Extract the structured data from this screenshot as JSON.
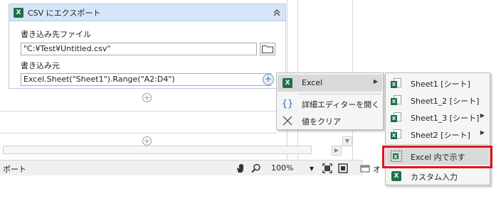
{
  "card": {
    "title": "CSV にエクスポート",
    "dest_label": "書き込み先ファイル",
    "dest_value": "\"C:¥Test¥Untitled.csv\"",
    "source_label": "書き込み元",
    "source_value": "Excel.Sheet(\"Sheet1\").Range(\"A2:D4\")"
  },
  "statusbar": {
    "left_text": "ポート",
    "zoom": "100%",
    "right_text": "オ"
  },
  "menu1": {
    "items": [
      {
        "label": "Excel",
        "icon": "excel-icon",
        "has_submenu": true
      },
      {
        "label": "詳細エディターを開く",
        "icon": "braces-icon"
      },
      {
        "label": "値をクリア",
        "icon": "clear-x-icon"
      }
    ]
  },
  "menu2": {
    "items": [
      {
        "label": "Sheet1 [シート]",
        "has_submenu": false
      },
      {
        "label": "Sheet1_2 [シート]",
        "has_submenu": false
      },
      {
        "label": "Sheet1_3 [シート]",
        "has_submenu": true
      },
      {
        "label": "Sheet2 [シート]",
        "has_submenu": true
      },
      {
        "label": "Excel 内で示す",
        "icon": "show-in-excel-icon"
      },
      {
        "label": "カスタム入力",
        "icon": "excel-icon"
      }
    ]
  },
  "colors": {
    "highlight_border": "#e0141e",
    "card_header": "#d6e6f8",
    "excel_green": "#1e7145"
  }
}
